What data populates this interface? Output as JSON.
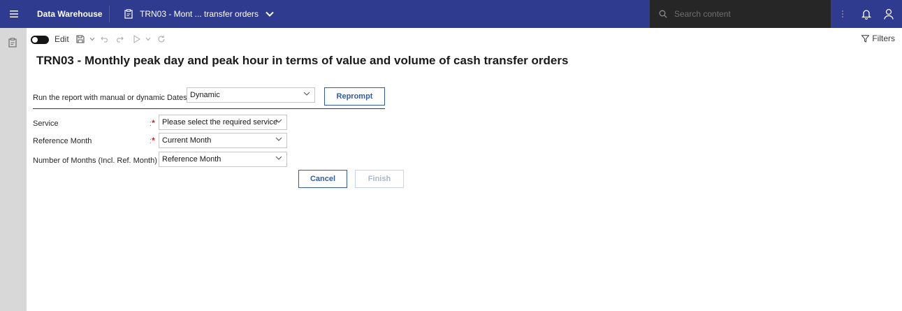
{
  "topbar": {
    "app_name": "Data Warehouse",
    "report_tab": "TRN03 - Mont ... transfer orders",
    "search_placeholder": "Search content"
  },
  "toolbar": {
    "edit_label": "Edit",
    "edit_toggle_on": false,
    "filters_label": "Filters"
  },
  "report": {
    "title": "TRN03 - Monthly peak day and peak hour in terms of value and volume of cash transfer orders"
  },
  "form": {
    "dates": {
      "label": "Run the report with manual or dynamic Dates",
      "value": "Dynamic",
      "required": true
    },
    "reprompt_label": "Reprompt",
    "service": {
      "label": "Service",
      "value": "Please select the required service",
      "required": true
    },
    "reference_month": {
      "label": "Reference Month",
      "value": "Current Month",
      "required": true
    },
    "number_of_months": {
      "label": "Number of Months (Incl. Ref. Month)",
      "value": "Reference Month",
      "required": true
    },
    "cancel_label": "Cancel",
    "finish_label": "Finish",
    "finish_enabled": false
  },
  "colors": {
    "topbar_bg": "#2f3b8e",
    "search_bg": "#262626",
    "rail_bg": "#d8d8d8",
    "button_accent": "#2f5ca8",
    "required_marker": "#da1e28"
  }
}
